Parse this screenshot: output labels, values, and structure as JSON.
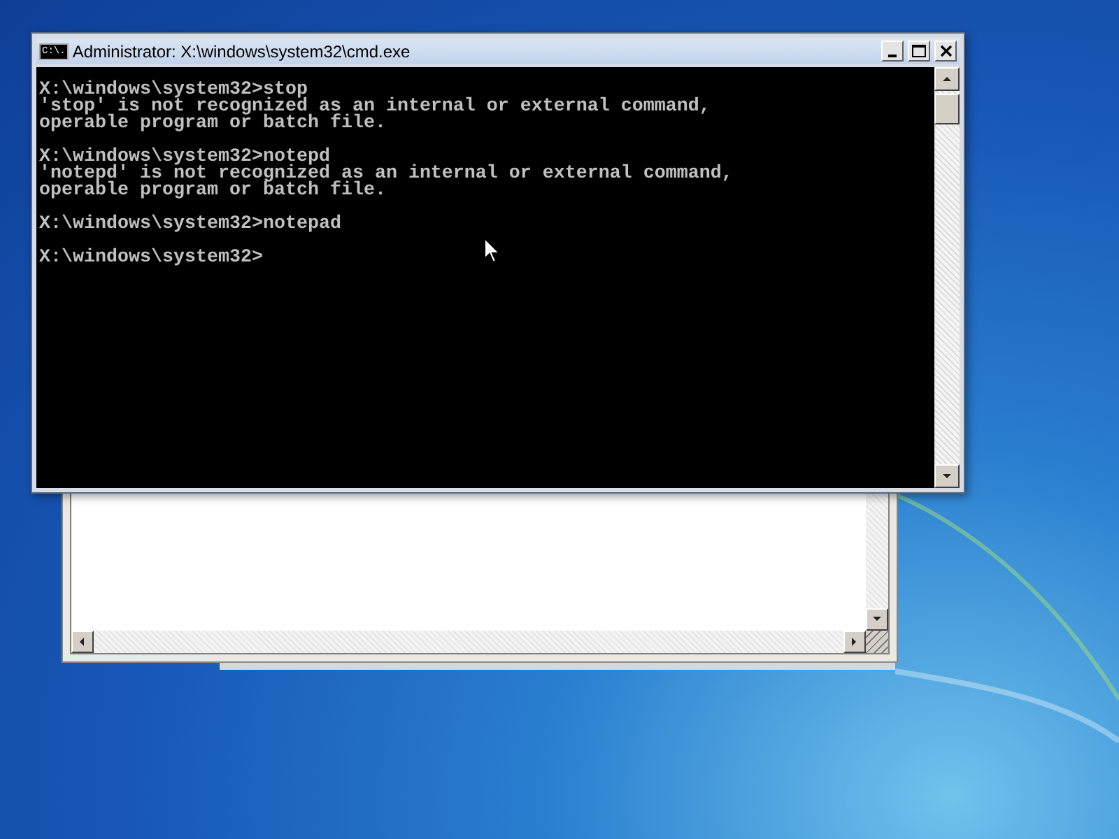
{
  "console_window": {
    "title": "Administrator: X:\\windows\\system32\\cmd.exe",
    "icon_text": "C:\\.",
    "blocks": [
      [
        "X:\\windows\\system32>stop",
        "'stop' is not recognized as an internal or external command,",
        "operable program or batch file."
      ],
      [
        "X:\\windows\\system32>notepd",
        "'notepd' is not recognized as an internal or external command,",
        "operable program or batch file."
      ],
      [
        "X:\\windows\\system32>notepad"
      ],
      [
        "X:\\windows\\system32>"
      ]
    ]
  }
}
